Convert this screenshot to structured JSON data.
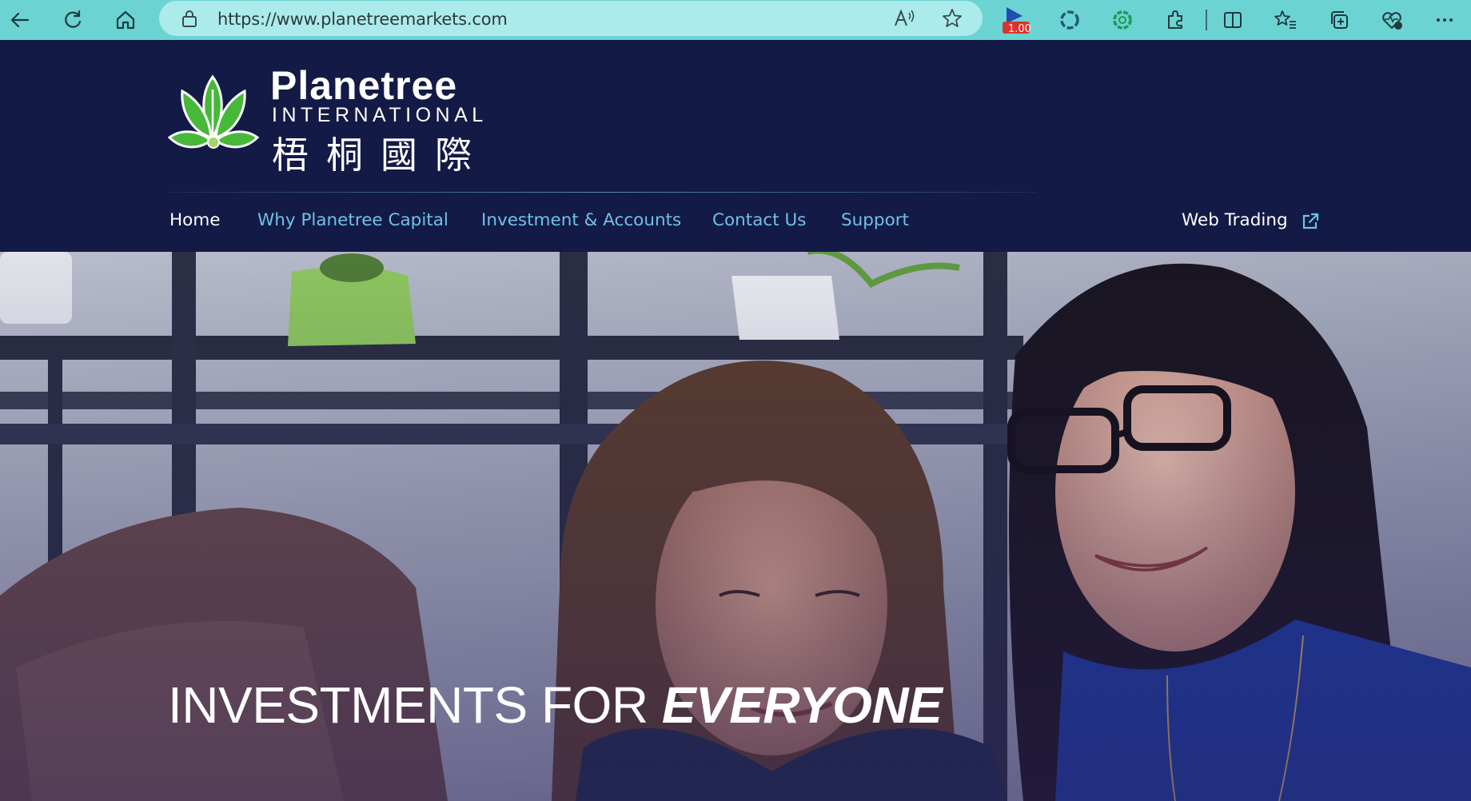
{
  "browser": {
    "url": "https://www.planetreemarkets.com",
    "badge": "1.00",
    "icons": [
      "back-arrow-icon",
      "refresh-icon",
      "home-icon",
      "lock-icon",
      "read-aloud-icon",
      "favorite-star-icon",
      "media-badge-icon",
      "extension-icon",
      "chatgpt-icon",
      "puzzle-icon",
      "split-screen-icon",
      "favorites-icon",
      "collections-icon",
      "heart-pulse-icon",
      "more-icon"
    ]
  },
  "brand": {
    "name": "Planetree",
    "sub": "INTERNATIONAL",
    "chinese": "梧桐國際",
    "colors": {
      "navy": "#131a46",
      "leaf_green": "#47b83a",
      "link": "#6ec2e8"
    }
  },
  "nav": {
    "items": [
      {
        "label": "Home"
      },
      {
        "label": "Why Planetree Capital"
      },
      {
        "label": "Investment & Accounts"
      },
      {
        "label": "Contact Us"
      },
      {
        "label": "Support"
      }
    ],
    "web_trading": "Web Trading"
  },
  "hero": {
    "headline_regular": "INVESTMENTS FOR ",
    "headline_emphasis": "EVERYONE"
  }
}
